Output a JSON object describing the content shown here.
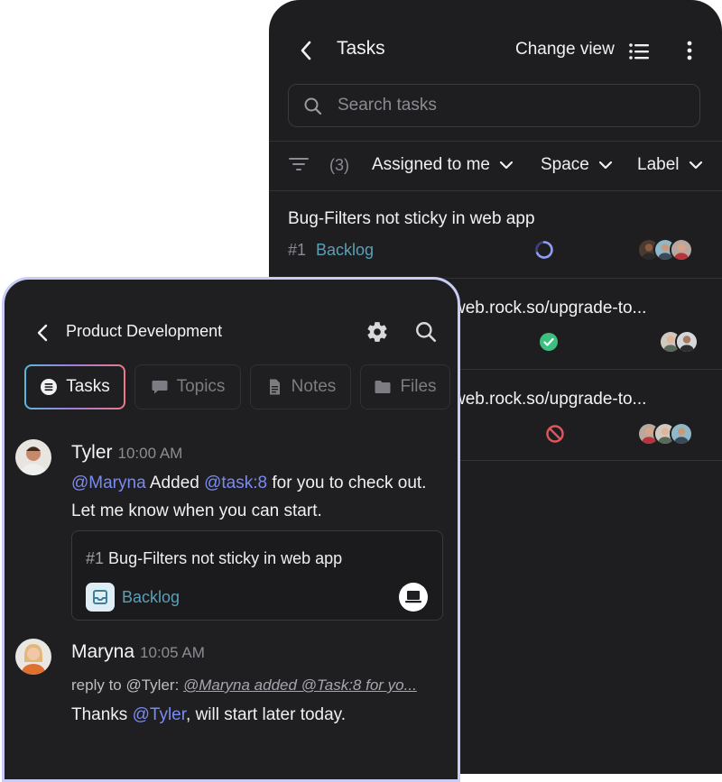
{
  "tasks_screen": {
    "title": "Tasks",
    "change_view_label": "Change view",
    "search_placeholder": "Search tasks",
    "filter_count": "(3)",
    "filters": [
      "Assigned to me",
      "Space",
      "Label"
    ],
    "tasks": [
      {
        "title": "Bug-Filters not sticky in web app",
        "number": "#1",
        "status": "Backlog",
        "status_icon": "in-progress-ring-icon"
      },
      {
        "title": "web.rock.so/upgrade-to...",
        "status_icon": "done-check-icon"
      },
      {
        "title": "web.rock.so/upgrade-to...",
        "status_icon": "blocked-icon"
      }
    ]
  },
  "chat_screen": {
    "title": "Product Development",
    "tabs": [
      "Tasks",
      "Topics",
      "Notes",
      "Files"
    ],
    "active_tab": "Tasks",
    "messages": [
      {
        "author": "Tyler",
        "time": "10:00 AM",
        "mention_user": "@Maryna",
        "text_1": " Added ",
        "mention_task": "@task:8",
        "text_2": " for you to check out. Let me know when you can start.",
        "card": {
          "number": "#1",
          "title": "Bug-Filters not sticky in web app",
          "status": "Backlog"
        }
      },
      {
        "author": "Maryna",
        "time": "10:05 AM",
        "reply_prefix": "reply to @Tyler: ",
        "reply_quote": "@Maryna added @Task:8 for yo...",
        "text_1": "Thanks ",
        "mention_user": "@Tyler",
        "text_2": ", will start later today."
      }
    ]
  },
  "colors": {
    "panel_bg": "#1e1e21",
    "mention": "#7a8bf0",
    "status_blue": "#5aa0b8",
    "done_green": "#3fbf7f",
    "blocked_red": "#e0565b",
    "progress_ring": "#8e9cf2"
  }
}
